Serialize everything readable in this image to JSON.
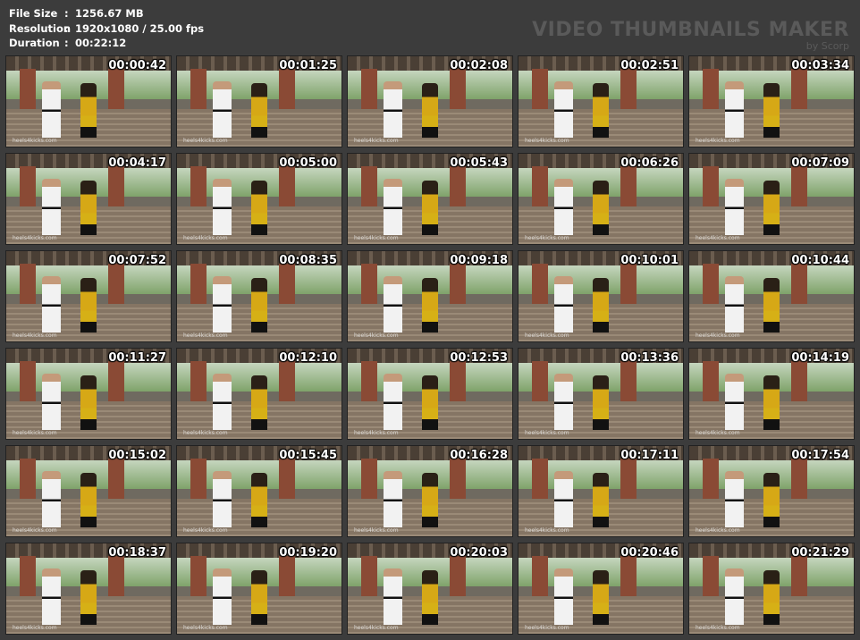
{
  "info": {
    "file_size_label": "File Size",
    "file_size": "1256.67 MB",
    "resolution_label": "Resolution",
    "resolution": "1920x1080 / 25.00 fps",
    "duration_label": "Duration",
    "duration": "00:22:12",
    "separator": ":"
  },
  "brand": {
    "title": "VIDEO THUMBNAILS MAKER",
    "subtitle": "by Scorp"
  },
  "watermark": "heels4kicks.com",
  "thumbnails": [
    {
      "timestamp": "00:00:42"
    },
    {
      "timestamp": "00:01:25"
    },
    {
      "timestamp": "00:02:08"
    },
    {
      "timestamp": "00:02:51"
    },
    {
      "timestamp": "00:03:34"
    },
    {
      "timestamp": "00:04:17"
    },
    {
      "timestamp": "00:05:00"
    },
    {
      "timestamp": "00:05:43"
    },
    {
      "timestamp": "00:06:26"
    },
    {
      "timestamp": "00:07:09"
    },
    {
      "timestamp": "00:07:52"
    },
    {
      "timestamp": "00:08:35"
    },
    {
      "timestamp": "00:09:18"
    },
    {
      "timestamp": "00:10:01"
    },
    {
      "timestamp": "00:10:44"
    },
    {
      "timestamp": "00:11:27"
    },
    {
      "timestamp": "00:12:10"
    },
    {
      "timestamp": "00:12:53"
    },
    {
      "timestamp": "00:13:36"
    },
    {
      "timestamp": "00:14:19"
    },
    {
      "timestamp": "00:15:02"
    },
    {
      "timestamp": "00:15:45"
    },
    {
      "timestamp": "00:16:28"
    },
    {
      "timestamp": "00:17:11"
    },
    {
      "timestamp": "00:17:54"
    },
    {
      "timestamp": "00:18:37"
    },
    {
      "timestamp": "00:19:20"
    },
    {
      "timestamp": "00:20:03"
    },
    {
      "timestamp": "00:20:46"
    },
    {
      "timestamp": "00:21:29"
    }
  ]
}
